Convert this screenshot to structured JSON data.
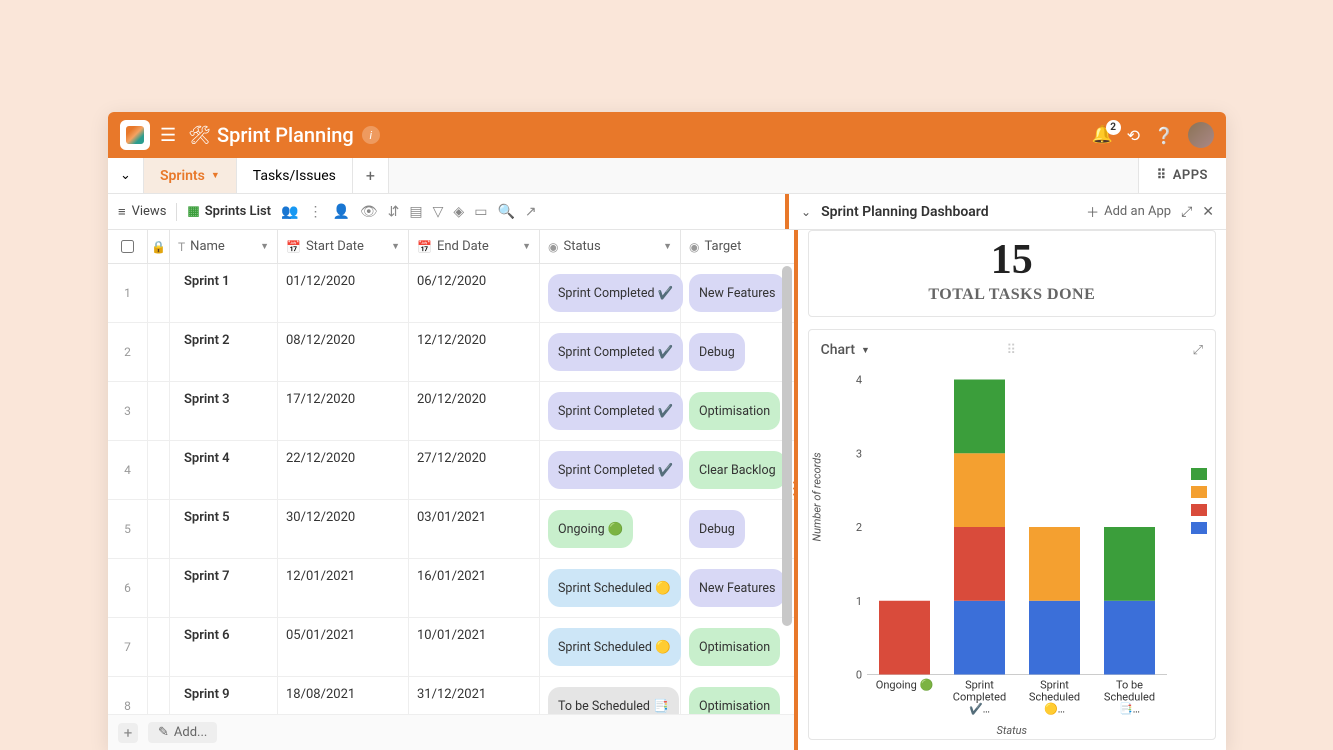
{
  "topbar": {
    "title": "Sprint Planning",
    "notification_count": "2"
  },
  "tabs": {
    "sprints": "Sprints",
    "tasks": "Tasks/Issues",
    "apps": "APPS"
  },
  "toolbar": {
    "views": "Views",
    "sprints_list": "Sprints List",
    "dashboard_title": "Sprint Planning Dashboard",
    "add_app": "Add an App"
  },
  "columns": {
    "name": "Name",
    "start_date": "Start Date",
    "end_date": "End Date",
    "status": "Status",
    "target": "Target"
  },
  "status_pills": {
    "completed": "Sprint Completed ✔️",
    "ongoing": "Ongoing 🟢",
    "scheduled": "Sprint Scheduled 🟡",
    "tobe": "To be Scheduled 📑"
  },
  "target_pills": {
    "new_features": "New Features",
    "debug": "Debug",
    "optimisation": "Optimisation",
    "clear_backlog": "Clear Backlog"
  },
  "rows": [
    {
      "idx": "1",
      "name": "Sprint 1",
      "start": "01/12/2020",
      "end": "06/12/2020",
      "statusKey": "completed",
      "targetKey": "new_features"
    },
    {
      "idx": "2",
      "name": "Sprint 2",
      "start": "08/12/2020",
      "end": "12/12/2020",
      "statusKey": "completed",
      "targetKey": "debug"
    },
    {
      "idx": "3",
      "name": "Sprint 3",
      "start": "17/12/2020",
      "end": "20/12/2020",
      "statusKey": "completed",
      "targetKey": "optimisation"
    },
    {
      "idx": "4",
      "name": "Sprint 4",
      "start": "22/12/2020",
      "end": "27/12/2020",
      "statusKey": "completed",
      "targetKey": "clear_backlog"
    },
    {
      "idx": "5",
      "name": "Sprint 5",
      "start": "30/12/2020",
      "end": "03/01/2021",
      "statusKey": "ongoing",
      "targetKey": "debug"
    },
    {
      "idx": "6",
      "name": "Sprint 7",
      "start": "12/01/2021",
      "end": "16/01/2021",
      "statusKey": "scheduled",
      "targetKey": "new_features"
    },
    {
      "idx": "7",
      "name": "Sprint 6",
      "start": "05/01/2021",
      "end": "10/01/2021",
      "statusKey": "scheduled",
      "targetKey": "optimisation"
    },
    {
      "idx": "8",
      "name": "Sprint 9",
      "start": "18/08/2021",
      "end": "31/12/2021",
      "statusKey": "tobe",
      "targetKey": "optimisation"
    }
  ],
  "addrow": {
    "label": "Add..."
  },
  "metric": {
    "value": "15",
    "label": "TOTAL TASKS DONE"
  },
  "chart": {
    "title": "Chart",
    "y_label": "Number of records",
    "x_label": "Status"
  },
  "chart_data": {
    "type": "bar",
    "stacked": true,
    "ylabel": "Number of records",
    "xlabel": "Status",
    "ylim": [
      0,
      4
    ],
    "categories": [
      "Ongoing 🟢",
      "Sprint Completed ✔️…",
      "Sprint Scheduled 🟡…",
      "To be Scheduled 📑…"
    ],
    "series_colors": [
      "#3b9e3b",
      "#f4a030",
      "#d94b3b",
      "#3b6fd9"
    ],
    "stacks": [
      [
        {
          "color": "#d94b3b",
          "value": 1
        }
      ],
      [
        {
          "color": "#3b6fd9",
          "value": 1
        },
        {
          "color": "#d94b3b",
          "value": 1
        },
        {
          "color": "#f4a030",
          "value": 1
        },
        {
          "color": "#3b9e3b",
          "value": 1
        }
      ],
      [
        {
          "color": "#3b6fd9",
          "value": 1
        },
        {
          "color": "#f4a030",
          "value": 1
        }
      ],
      [
        {
          "color": "#3b6fd9",
          "value": 1
        },
        {
          "color": "#3b9e3b",
          "value": 1
        }
      ]
    ]
  },
  "pill_class_map": {
    "completed": "pill-lav",
    "ongoing": "pill-green",
    "scheduled": "pill-blue",
    "tobe": "pill-gray",
    "new_features": "pill-lav",
    "debug": "pill-lav",
    "optimisation": "pill-green",
    "clear_backlog": "pill-green"
  }
}
